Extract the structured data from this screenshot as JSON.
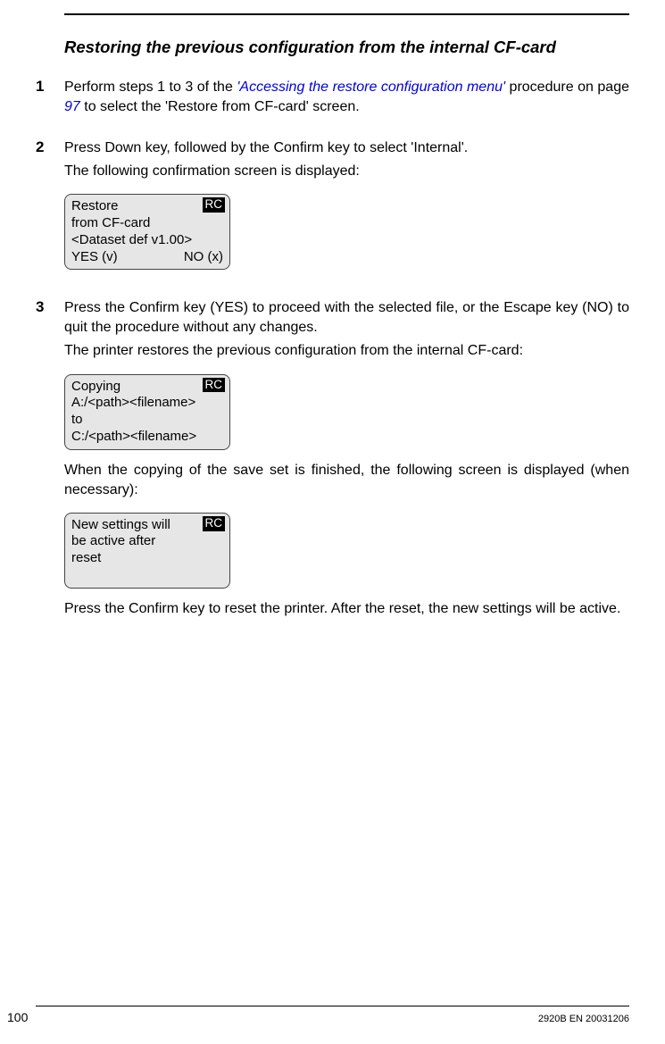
{
  "title": "Restoring the previous configuration from the internal CF-card",
  "steps": {
    "s1": {
      "num": "1",
      "para_a": "Perform steps 1 to 3 of the ",
      "link_text": "'Accessing the restore configuration menu'",
      "para_b": " procedure on page ",
      "link_num": "97",
      "para_c": " to select the 'Restore from CF-card' screen."
    },
    "s2": {
      "num": "2",
      "para_a": "Press Down key, followed by the Confirm key to select 'Internal'.",
      "para_b": "The following confirmation screen is displayed:",
      "lcd": {
        "badge": "RC",
        "l1": "Restore",
        "l2": "from CF-card",
        "l3": "<Dataset def v1.00>",
        "l4a": "YES (v)",
        "l4b": "NO (x)"
      }
    },
    "s3": {
      "num": "3",
      "para_a": "Press the Confirm key (YES) to proceed with the selected file, or the Escape key (NO) to quit the procedure without any changes.",
      "para_b": "The printer restores the previous configuration from the internal CF-card:",
      "lcd1": {
        "badge": "RC",
        "l1": "Copying",
        "l2": "A:/<path><filename>",
        "l3": "to",
        "l4": "C:/<path><filename>"
      },
      "para_c": "When the copying of the save set is finished, the following screen is displayed (when necessary):",
      "lcd2": {
        "badge": "RC",
        "l1": "New settings will",
        "l2": "be active after",
        "l3": "reset"
      },
      "para_d": "Press the Confirm key to reset the printer. After the reset, the new settings will be active."
    }
  },
  "footer": {
    "page": "100",
    "code": "2920B EN 20031206"
  }
}
